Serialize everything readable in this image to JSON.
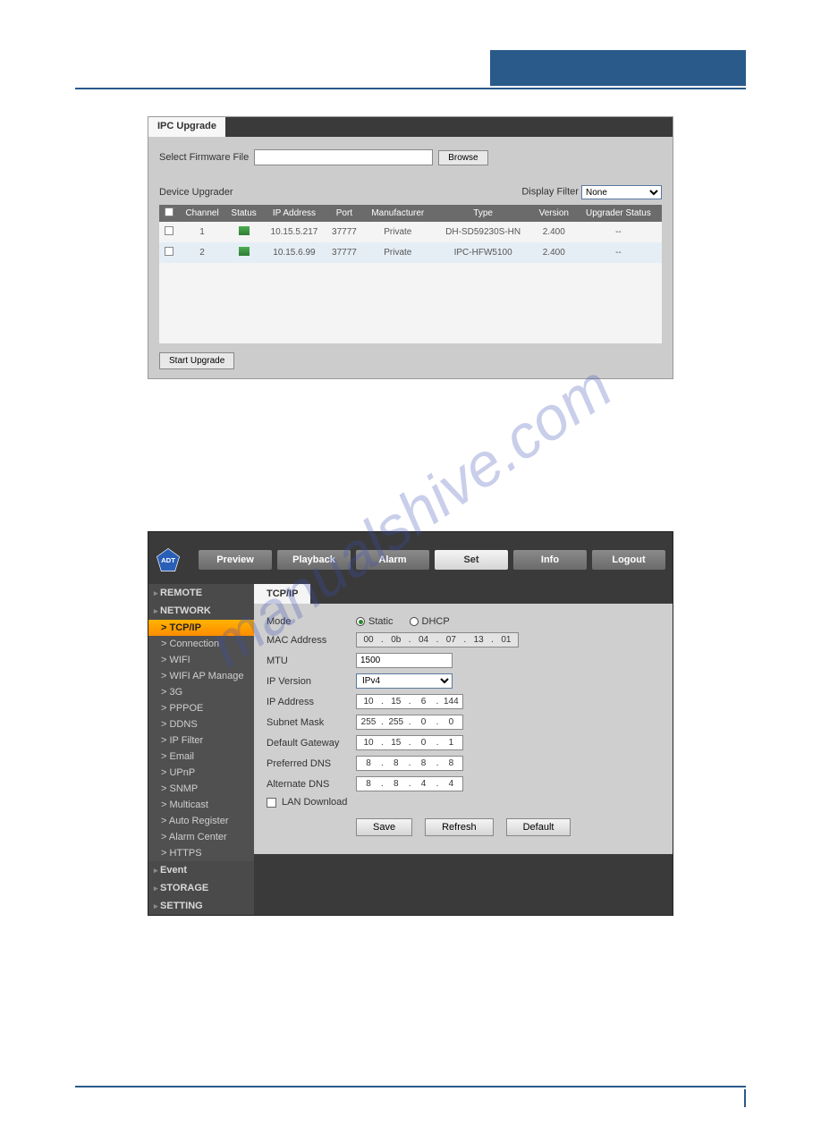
{
  "panel1": {
    "tab": "IPC Upgrade",
    "selectLabel": "Select Firmware File",
    "browse": "Browse",
    "deviceUpgrader": "Device Upgrader",
    "displayFilter": "Display Filter",
    "filterValue": "None",
    "headers": [
      "",
      "Channel",
      "Status",
      "IP Address",
      "Port",
      "Manufacturer",
      "Type",
      "Version",
      "Upgrader Status"
    ],
    "rows": [
      {
        "ch": "1",
        "ip": "10.15.5.217",
        "port": "37777",
        "mfg": "Private",
        "type": "DH-SD59230S-HN",
        "ver": "2.400",
        "ustat": "--"
      },
      {
        "ch": "2",
        "ip": "10.15.6.99",
        "port": "37777",
        "mfg": "Private",
        "type": "IPC-HFW5100",
        "ver": "2.400",
        "ustat": "--"
      }
    ],
    "startUpgrade": "Start Upgrade"
  },
  "panel2": {
    "nav": [
      "Preview",
      "Playback",
      "Alarm",
      "Set",
      "Info",
      "Logout"
    ],
    "navActive": 3,
    "sidebar": {
      "cats": [
        {
          "label": "REMOTE",
          "items": []
        },
        {
          "label": "NETWORK",
          "items": [
            "TCP/IP",
            "Connection",
            "WIFI",
            "WIFI AP Manage",
            "3G",
            "PPPOE",
            "DDNS",
            "IP Filter",
            "Email",
            "UPnP",
            "SNMP",
            "Multicast",
            "Auto Register",
            "Alarm Center",
            "HTTPS"
          ]
        },
        {
          "label": "Event",
          "items": []
        },
        {
          "label": "STORAGE",
          "items": []
        },
        {
          "label": "SETTING",
          "items": []
        }
      ],
      "activeItem": "TCP/IP"
    },
    "contentTab": "TCP/IP",
    "form": {
      "modeLabel": "Mode",
      "modeStatic": "Static",
      "modeDHCP": "DHCP",
      "macLabel": "MAC Address",
      "mac": [
        "00",
        "0b",
        "04",
        "07",
        "13",
        "01"
      ],
      "mtuLabel": "MTU",
      "mtu": "1500",
      "ipvLabel": "IP Version",
      "ipv": "IPv4",
      "ipLabel": "IP Address",
      "ip": [
        "10",
        "15",
        "6",
        "144"
      ],
      "subnetLabel": "Subnet Mask",
      "subnet": [
        "255",
        "255",
        "0",
        "0"
      ],
      "gwLabel": "Default Gateway",
      "gw": [
        "10",
        "15",
        "0",
        "1"
      ],
      "pdnsLabel": "Preferred DNS",
      "pdns": [
        "8",
        "8",
        "8",
        "8"
      ],
      "adnsLabel": "Alternate DNS",
      "adns": [
        "8",
        "8",
        "4",
        "4"
      ],
      "lan": "LAN Download",
      "save": "Save",
      "refresh": "Refresh",
      "default": "Default"
    }
  },
  "watermark": "manualshive.com"
}
